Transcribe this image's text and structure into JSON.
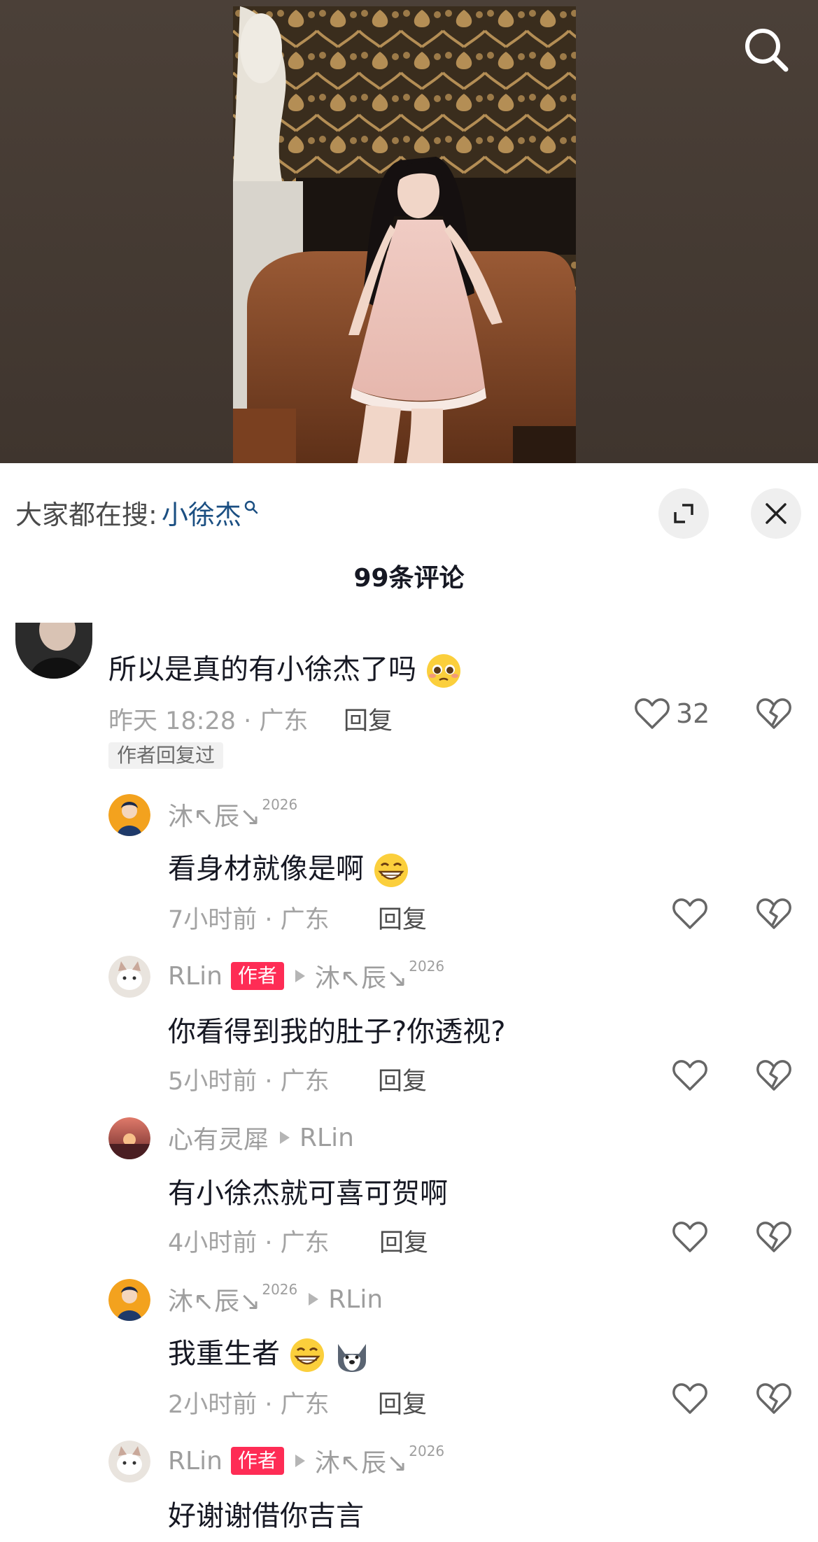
{
  "header": {
    "search_icon": "search-icon"
  },
  "sheet": {
    "hot_search_label": "大家都在搜:",
    "hot_search_keyword": "小徐杰",
    "expand_icon": "expand-icon",
    "close_icon": "close-icon",
    "comment_count": "99条评论"
  },
  "comments": {
    "main": {
      "text": "所以是真的有小徐杰了吗",
      "emoji": "pleading-face-emoji",
      "meta": "昨天 18:28 · 广东",
      "reply_label": "回复",
      "likes": "32",
      "badge": "作者回复过"
    },
    "replies": [
      {
        "user": "沐↖辰↘",
        "user_sup": "2026",
        "text": "看身材就像是啊",
        "emoji": "grin-emoji",
        "meta": "7小时前 · 广东",
        "reply_label": "回复"
      },
      {
        "user": "RLin",
        "tag": "作者",
        "reply_to": "沐↖辰↘",
        "reply_to_sup": "2026",
        "text": "你看得到我的肚子?你透视?",
        "meta": "5小时前 · 广东",
        "reply_label": "回复"
      },
      {
        "user": "心有灵犀",
        "reply_to": "RLin",
        "text": "有小徐杰就可喜可贺啊",
        "meta": "4小时前 · 广东",
        "reply_label": "回复"
      },
      {
        "user": "沐↖辰↘",
        "user_sup": "2026",
        "reply_to": "RLin",
        "text": "我重生者",
        "emoji": "grin-emoji",
        "emoji2": "husky-emoji",
        "meta": "2小时前 · 广东",
        "reply_label": "回复"
      },
      {
        "user": "RLin",
        "tag": "作者",
        "reply_to": "沐↖辰↘",
        "reply_to_sup": "2026",
        "text": "好谢谢借你吉言"
      }
    ]
  },
  "colors": {
    "accent_link": "#1b4f82",
    "author_tag": "#fe2c55",
    "top_background": "#4a3f37"
  }
}
